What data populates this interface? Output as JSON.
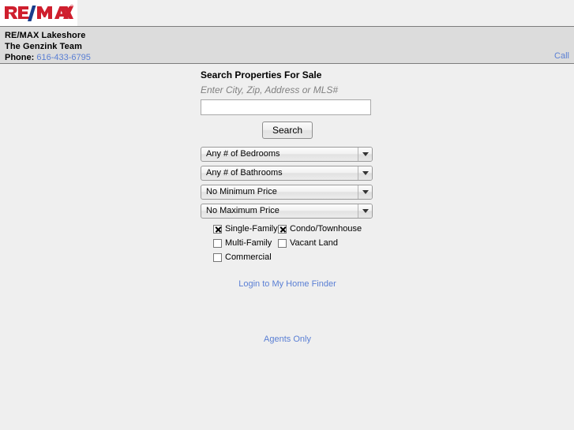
{
  "brand": {
    "logo_name": "remax-logo",
    "logo_text": "RE/MAX",
    "logo_red": "#cf1f2e",
    "logo_blue": "#1b3d8c"
  },
  "header": {
    "office_name": "RE/MAX Lakeshore",
    "team_name": "The Genzink Team",
    "phone_label": "Phone:",
    "phone_number": "616-433-6795",
    "call_link": "Call",
    "link_color": "#5a7fd4"
  },
  "search": {
    "title": "Search Properties For Sale",
    "hint": "Enter City, Zip, Address or MLS#",
    "input_value": "",
    "input_placeholder": "",
    "button_label": "Search"
  },
  "filters": [
    {
      "name": "bedrooms",
      "selected": "Any # of Bedrooms"
    },
    {
      "name": "bathrooms",
      "selected": "Any # of Bathrooms"
    },
    {
      "name": "min-price",
      "selected": "No Minimum Price"
    },
    {
      "name": "max-price",
      "selected": "No Maximum Price"
    }
  ],
  "property_types": {
    "rows": [
      [
        {
          "label": "Single-Family",
          "checked": true
        },
        {
          "label": "Condo/Townhouse",
          "checked": true
        }
      ],
      [
        {
          "label": "Multi-Family",
          "checked": false
        },
        {
          "label": "Vacant Land",
          "checked": false
        }
      ],
      [
        {
          "label": "Commercial",
          "checked": false
        }
      ]
    ]
  },
  "links": {
    "home_finder": "Login to My Home Finder",
    "agents_only": "Agents Only"
  }
}
